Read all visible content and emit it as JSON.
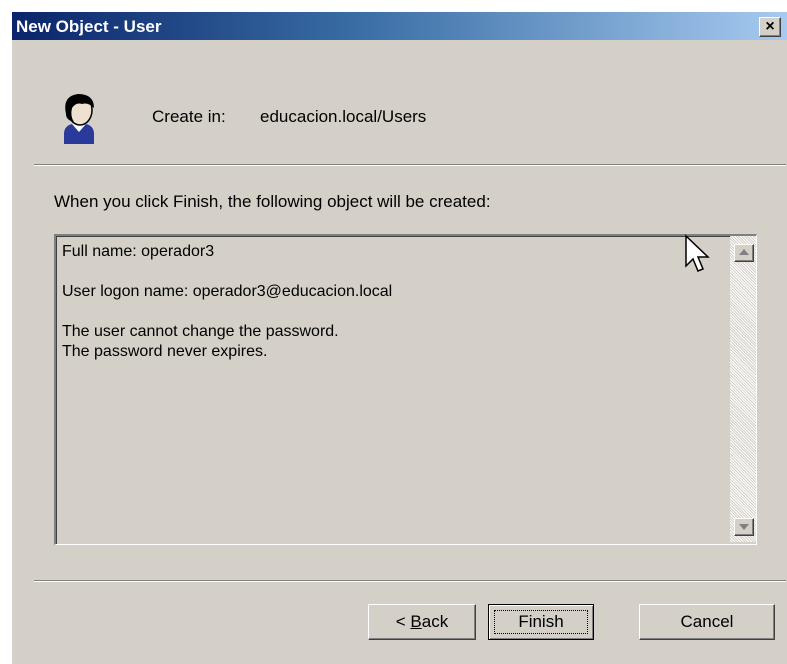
{
  "window": {
    "title": "New Object - User",
    "close_label": "×"
  },
  "header": {
    "create_in_label": "Create in:",
    "create_in_value": "educacion.local/Users",
    "icon": "user-icon"
  },
  "description": "When you click Finish, the following object will be created:",
  "summary": {
    "full_name": "Full name: operador3",
    "logon_name": "User logon name: operador3@educacion.local",
    "line_password_change": "The user cannot change the password.",
    "line_password_expire": "The password never expires."
  },
  "buttons": {
    "back_prefix": "< ",
    "back_key": "B",
    "back_rest": "ack",
    "finish": "Finish",
    "cancel": "Cancel"
  },
  "colors": {
    "title_start": "#0a246a",
    "title_end": "#a6caf0",
    "face": "#d4d0c8"
  }
}
